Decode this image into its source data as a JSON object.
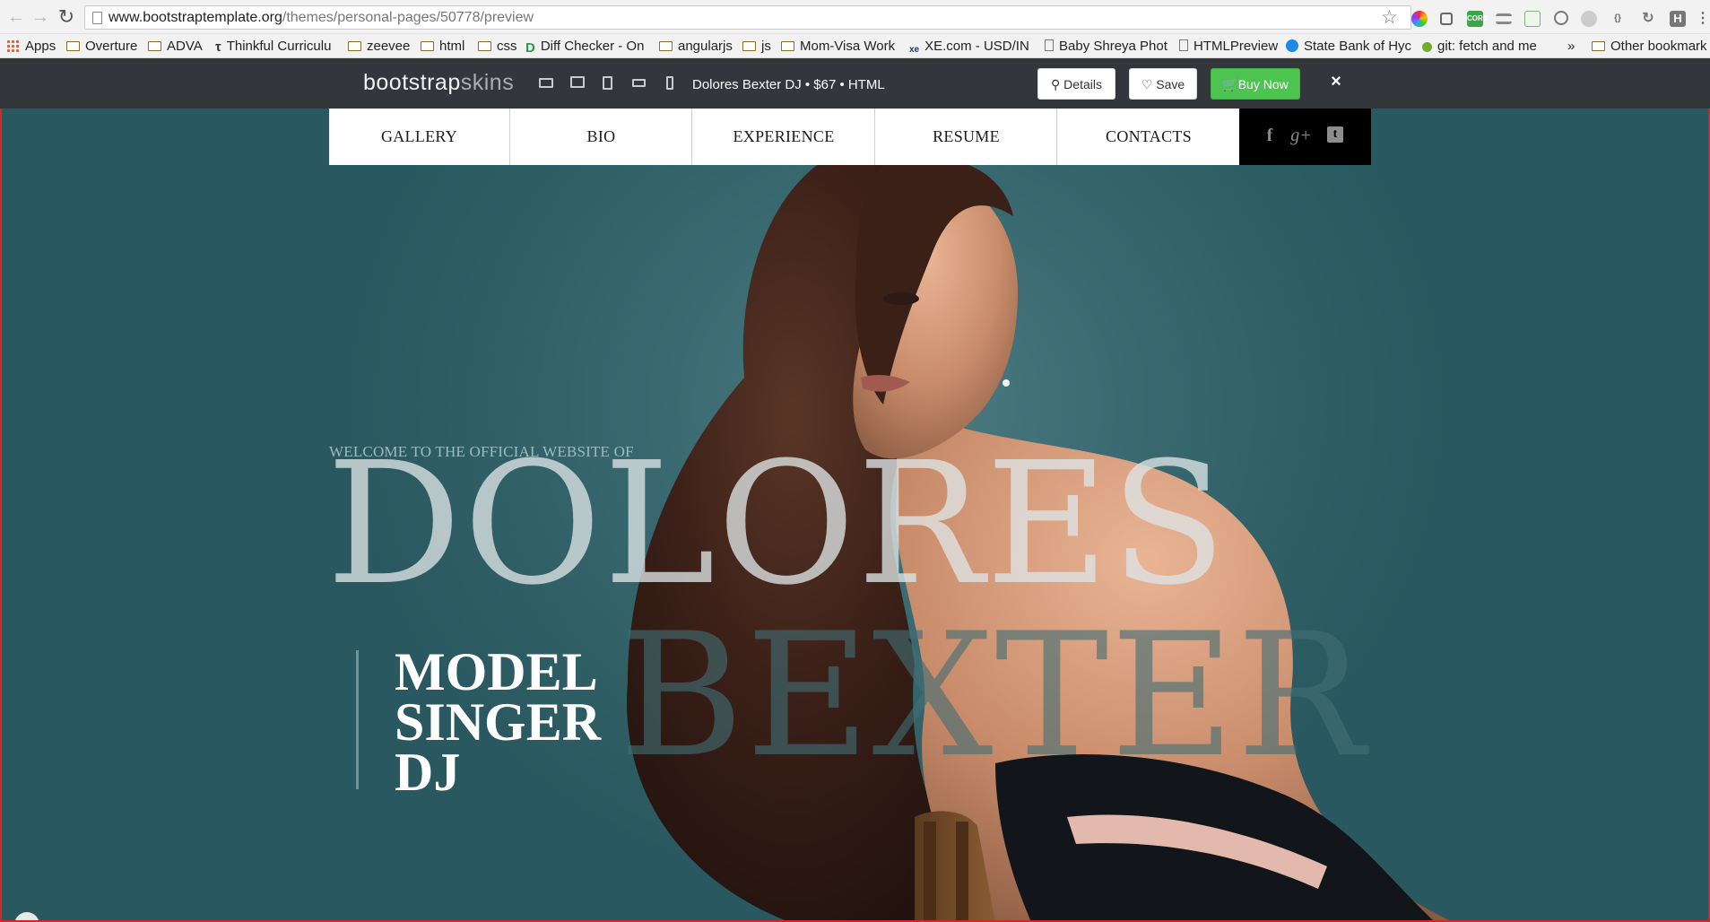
{
  "browser": {
    "url_host": "www.bootstraptemplate.org",
    "url_path": "/themes/personal-pages/50778/preview",
    "ext_cors": "CORS",
    "ext_braces": "{}",
    "ext_h": "H",
    "bookmarks": [
      {
        "label": "Apps",
        "icon": "apps-grid-icon"
      },
      {
        "label": "Overture",
        "icon": "folder-icon"
      },
      {
        "label": "ADVA",
        "icon": "folder-icon"
      },
      {
        "label": "Thinkful Curriculu",
        "icon": "bookmark-icon"
      },
      {
        "label": "zeevee",
        "icon": "folder-icon"
      },
      {
        "label": "html",
        "icon": "folder-icon"
      },
      {
        "label": "css",
        "icon": "folder-icon"
      },
      {
        "label": "Diff Checker - On",
        "icon": "diffchecker-icon"
      },
      {
        "label": "angularjs",
        "icon": "folder-icon"
      },
      {
        "label": "js",
        "icon": "folder-icon"
      },
      {
        "label": "Mom-Visa Work",
        "icon": "folder-icon"
      },
      {
        "label": "XE.com - USD/IN",
        "icon": "xe-icon"
      },
      {
        "label": "Baby Shreya Phot",
        "icon": "page-icon"
      },
      {
        "label": "HTMLPreview",
        "icon": "page-icon"
      },
      {
        "label": "State Bank of Hyc",
        "icon": "sbh-icon"
      },
      {
        "label": "git: fetch and me",
        "icon": "git-icon"
      },
      {
        "label": "»",
        "icon": "overflow-chevron-icon"
      },
      {
        "label": "Other bookmark",
        "icon": "folder-icon"
      }
    ]
  },
  "preview_bar": {
    "brand_part1": "bootstrap",
    "brand_part2": "skins",
    "title": "Dolores Bexter DJ • $67 • HTML",
    "details_label": "Details",
    "save_label": "Save",
    "buy_label": "Buy Now",
    "close_label": "×",
    "colors": {
      "bar": "#33373c",
      "buy": "#4cc44f"
    }
  },
  "site": {
    "nav": [
      "GALLERY",
      "BIO",
      "EXPERIENCE",
      "RESUME",
      "CONTACTS"
    ],
    "social": {
      "facebook": "f",
      "googleplus": "g+",
      "twitter": "t"
    },
    "welcome": "WELCOME TO THE OFFICIAL WEBSITE OF",
    "first_name": "DOLORES",
    "last_name": "BEXTER",
    "roles": [
      "MODEL",
      "SINGER",
      "DJ"
    ],
    "colors": {
      "background": "#2f5e65"
    }
  }
}
